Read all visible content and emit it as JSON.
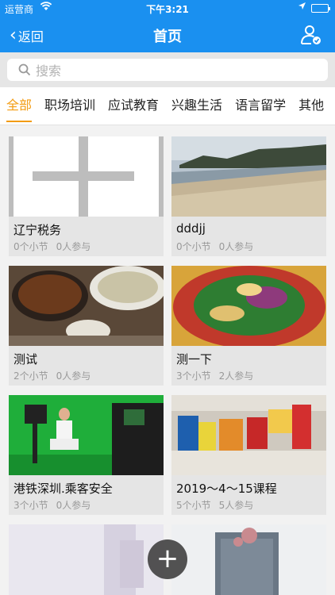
{
  "status": {
    "carrier": "运营商",
    "time": "下午3:21"
  },
  "nav": {
    "back_label": "返回",
    "title": "首页"
  },
  "search": {
    "placeholder": "搜索"
  },
  "tabs": [
    {
      "label": "全部",
      "active": true
    },
    {
      "label": "职场培训"
    },
    {
      "label": "应试教育"
    },
    {
      "label": "兴趣生活"
    },
    {
      "label": "语言留学"
    },
    {
      "label": "其他"
    }
  ],
  "courses": [
    {
      "title": "辽宁税务",
      "sections": "0个小节",
      "participants": "0人参与",
      "image": "placeholder-cross"
    },
    {
      "title": "dddjj",
      "sections": "0个小节",
      "participants": "0人参与",
      "image": "beach"
    },
    {
      "title": "测试",
      "sections": "2个小节",
      "participants": "0人参与",
      "image": "food-pot"
    },
    {
      "title": "测一下",
      "sections": "3个小节",
      "participants": "2人参与",
      "image": "salad"
    },
    {
      "title": "港铁深圳.乘客安全",
      "sections": "3个小节",
      "participants": "0人参与",
      "image": "green-studio"
    },
    {
      "title": "2019～4～15课程",
      "sections": "5个小节",
      "participants": "5人参与",
      "image": "snacks"
    },
    {
      "title": "",
      "sections": "",
      "participants": "",
      "image": "pale-abstract"
    },
    {
      "title": "",
      "sections": "",
      "participants": "",
      "image": "building"
    }
  ],
  "fab": {
    "label": "+"
  },
  "colors": {
    "nav": "#1a90f0",
    "accent": "#f39c12"
  }
}
